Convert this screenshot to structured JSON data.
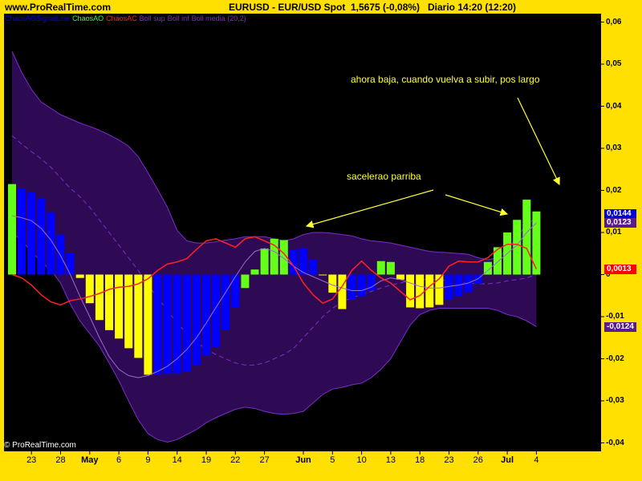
{
  "header": {
    "site": "www.ProRealTime.com",
    "instrument": "EURUSD - EUR/USD Spot",
    "price": "1,5675 (-0,08%)",
    "period": "Diario  14:20 (12:20)"
  },
  "legend": [
    {
      "label": "ChaosAOSignalLine",
      "color": "#0000FF"
    },
    {
      "label": "ChaosAO",
      "color": "#33FF33"
    },
    {
      "label": "ChaosAC",
      "color": "#FF2020"
    },
    {
      "label": "Boll sup",
      "color": "#7A2EC8"
    },
    {
      "label": "Boll inf",
      "color": "#7A2EC8"
    },
    {
      "label": "Boll media (20,2)",
      "color": "#7A2EC8"
    }
  ],
  "annotations": {
    "top": "ahora baja, cuando vuelva a subir, pos largo",
    "middle": "sacelerao parriba"
  },
  "copyright": "© ProRealTime.com",
  "value_boxes": [
    {
      "label": "0,0144",
      "color": "#0000DD",
      "value": 0.0144
    },
    {
      "label": "0,0123",
      "color": "#5A1A90",
      "value": 0.0123
    },
    {
      "label": "0,0013",
      "color": "#FF0000",
      "value": 0.0013
    },
    {
      "label": "-0,0124",
      "color": "#5A1A90",
      "value": -0.0124
    }
  ],
  "colors": {
    "background": "#000000",
    "frame": "#FFE000",
    "band": "#2E0A55",
    "band_edge": "#7A2EC8",
    "bar_green": "#66FF1A",
    "bar_yellow": "#FFFF00",
    "bar_blue": "#0000FF",
    "ac_line": "#FF2020",
    "signal_line": "#9B6BCF",
    "arrow": "#FFFF33"
  },
  "chart_data": {
    "type": "bar",
    "ylim": [
      -0.042,
      0.062
    ],
    "y_ticks": [
      "0,06",
      "0,05",
      "0,04",
      "0,03",
      "0,02",
      "0,01",
      "0",
      "-0,01",
      "-0,02",
      "-0,03",
      "-0,04"
    ],
    "y_tick_values": [
      0.06,
      0.05,
      0.04,
      0.03,
      0.02,
      0.01,
      0,
      -0.01,
      -0.02,
      -0.03,
      -0.04
    ],
    "x_ticks": [
      {
        "label": "23",
        "index": 2,
        "bold": false
      },
      {
        "label": "28",
        "index": 5,
        "bold": false
      },
      {
        "label": "May",
        "index": 8,
        "bold": true
      },
      {
        "label": "6",
        "index": 11,
        "bold": false
      },
      {
        "label": "9",
        "index": 14,
        "bold": false
      },
      {
        "label": "14",
        "index": 17,
        "bold": false
      },
      {
        "label": "19",
        "index": 20,
        "bold": false
      },
      {
        "label": "22",
        "index": 23,
        "bold": false
      },
      {
        "label": "27",
        "index": 26,
        "bold": false
      },
      {
        "label": "Jun",
        "index": 30,
        "bold": true
      },
      {
        "label": "5",
        "index": 33,
        "bold": false
      },
      {
        "label": "10",
        "index": 36,
        "bold": false
      },
      {
        "label": "13",
        "index": 39,
        "bold": false
      },
      {
        "label": "18",
        "index": 42,
        "bold": false
      },
      {
        "label": "23",
        "index": 45,
        "bold": false
      },
      {
        "label": "26",
        "index": 48,
        "bold": false
      },
      {
        "label": "Jul",
        "index": 51,
        "bold": true
      },
      {
        "label": "4",
        "index": 54,
        "bold": false
      }
    ],
    "ao_values": [
      0.0215,
      0.0205,
      0.0195,
      0.0182,
      0.0148,
      0.0095,
      0.0052,
      -0.0008,
      -0.0068,
      -0.0108,
      -0.0132,
      -0.0152,
      -0.0175,
      -0.0198,
      -0.0238,
      -0.0237,
      -0.0236,
      -0.0235,
      -0.023,
      -0.0215,
      -0.0192,
      -0.0172,
      -0.0132,
      -0.0078,
      -0.0032,
      0.0012,
      0.0062,
      0.0085,
      0.0082,
      0.0058,
      0.0062,
      0.0035,
      0.0,
      -0.0043,
      -0.0082,
      -0.0058,
      -0.0052,
      -0.0038,
      0.0032,
      0.003,
      -0.0012,
      -0.0078,
      -0.008,
      -0.0078,
      -0.0072,
      -0.006,
      -0.0052,
      -0.0042,
      -0.0022,
      0.003,
      0.0065,
      0.01,
      0.013,
      0.0178,
      0.015
    ],
    "ao_colors": [
      "g",
      "b",
      "b",
      "b",
      "b",
      "b",
      "b",
      "y",
      "y",
      "y",
      "y",
      "y",
      "y",
      "y",
      "y",
      "b",
      "b",
      "b",
      "b",
      "b",
      "b",
      "b",
      "b",
      "b",
      "g",
      "g",
      "g",
      "g",
      "g",
      "b",
      "b",
      "b",
      "y",
      "y",
      "y",
      "b",
      "b",
      "b",
      "g",
      "g",
      "y",
      "y",
      "y",
      "y",
      "y",
      "b",
      "b",
      "b",
      "b",
      "g",
      "g",
      "g",
      "g",
      "g",
      "g"
    ],
    "signal_line": [
      0.014,
      0.0135,
      0.0128,
      0.011,
      0.0082,
      0.0045,
      0.0,
      -0.0052,
      -0.01,
      -0.015,
      -0.0195,
      -0.0225,
      -0.024,
      -0.0245,
      -0.024,
      -0.023,
      -0.0218,
      -0.02,
      -0.0178,
      -0.015,
      -0.0115,
      -0.0078,
      -0.0042,
      -0.0005,
      0.003,
      0.0055,
      0.0062,
      0.0055,
      0.0038,
      0.002,
      0.0005,
      -0.0005,
      -0.0015,
      -0.0025,
      -0.0032,
      -0.0038,
      -0.0038,
      -0.003,
      -0.0015,
      -0.0008,
      -0.0012,
      -0.002,
      -0.0028,
      -0.0032,
      -0.0032,
      -0.0028,
      -0.0025,
      -0.002,
      -0.001,
      0.001,
      0.003,
      0.005,
      0.007,
      0.01,
      0.0123
    ],
    "ac_line": [
      0.0,
      -0.0008,
      -0.0025,
      -0.0048,
      -0.0065,
      -0.0072,
      -0.0062,
      -0.0058,
      -0.0052,
      -0.0045,
      -0.0035,
      -0.003,
      -0.0028,
      -0.0022,
      -0.001,
      0.001,
      0.0025,
      0.003,
      0.0038,
      0.006,
      0.008,
      0.0085,
      0.0075,
      0.0065,
      0.0085,
      0.009,
      0.008,
      0.007,
      0.005,
      0.002,
      -0.002,
      -0.0048,
      -0.0068,
      -0.0058,
      -0.0028,
      0.001,
      0.0032,
      0.001,
      -0.0008,
      -0.002,
      -0.004,
      -0.006,
      -0.005,
      -0.0028,
      -0.001,
      0.002,
      0.0032,
      0.003,
      0.003,
      0.004,
      0.006,
      0.0072,
      0.0072,
      0.0062,
      0.0013
    ],
    "boll_sup": [
      0.053,
      0.048,
      0.044,
      0.041,
      0.0395,
      0.038,
      0.037,
      0.036,
      0.0352,
      0.0343,
      0.0332,
      0.032,
      0.0305,
      0.028,
      0.0242,
      0.0202,
      0.016,
      0.0105,
      0.008,
      0.0075,
      0.0075,
      0.0078,
      0.0082,
      0.0085,
      0.009,
      0.009,
      0.009,
      0.0085,
      0.008,
      0.0085,
      0.0095,
      0.01,
      0.01,
      0.0098,
      0.0095,
      0.0092,
      0.0085,
      0.008,
      0.0078,
      0.0075,
      0.007,
      0.0065,
      0.006,
      0.0055,
      0.0053,
      0.0052,
      0.005,
      0.0048,
      0.004,
      0.0035,
      0.004,
      0.006,
      0.009,
      0.012,
      0.0135
    ],
    "boll_inf": [
      0.01,
      0.008,
      0.0055,
      0.003,
      0.001,
      -0.002,
      -0.007,
      -0.011,
      -0.014,
      -0.017,
      -0.021,
      -0.0252,
      -0.03,
      -0.0345,
      -0.0378,
      -0.0392,
      -0.0398,
      -0.0392,
      -0.038,
      -0.0368,
      -0.0352,
      -0.034,
      -0.033,
      -0.032,
      -0.0315,
      -0.0318,
      -0.0325,
      -0.033,
      -0.0332,
      -0.033,
      -0.0325,
      -0.0305,
      -0.0285,
      -0.0272,
      -0.0268,
      -0.0262,
      -0.0258,
      -0.0245,
      -0.0225,
      -0.02,
      -0.016,
      -0.012,
      -0.0095,
      -0.0085,
      -0.008,
      -0.008,
      -0.008,
      -0.008,
      -0.008,
      -0.008,
      -0.0085,
      -0.0095,
      -0.01,
      -0.011,
      -0.0124
    ],
    "boll_media": [
      0.033,
      0.031,
      0.0292,
      0.0275,
      0.0255,
      0.023,
      0.0205,
      0.0185,
      0.016,
      0.013,
      0.01,
      0.007,
      0.004,
      0.001,
      -0.0025,
      -0.0055,
      -0.0085,
      -0.0115,
      -0.014,
      -0.016,
      -0.0178,
      -0.019,
      -0.02,
      -0.021,
      -0.0215,
      -0.0215,
      -0.021,
      -0.02,
      -0.019,
      -0.0175,
      -0.015,
      -0.0125,
      -0.01,
      -0.008,
      -0.0065,
      -0.0055,
      -0.0048,
      -0.004,
      -0.0032,
      -0.0025,
      -0.002,
      -0.0015,
      -0.0012,
      -0.0012,
      -0.0012,
      -0.0015,
      -0.0018,
      -0.002,
      -0.0022,
      -0.0022,
      -0.002,
      -0.0015,
      -0.0012,
      -0.0008,
      0.0
    ]
  }
}
